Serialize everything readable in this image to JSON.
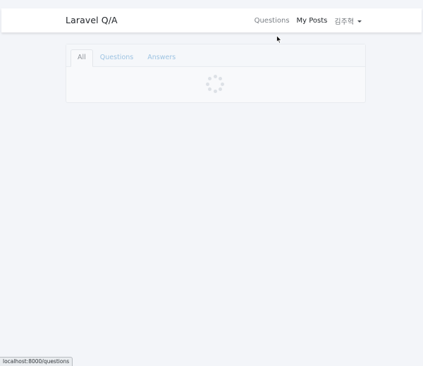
{
  "navbar": {
    "brand": "Laravel Q/A",
    "links": [
      {
        "label": "Questions"
      },
      {
        "label": "My Posts"
      }
    ],
    "user_name": "김주혁"
  },
  "tabs": [
    {
      "label": "All"
    },
    {
      "label": "Questions"
    },
    {
      "label": "Answers"
    }
  ],
  "status_bar": {
    "url": "localhost:8000/questions"
  }
}
